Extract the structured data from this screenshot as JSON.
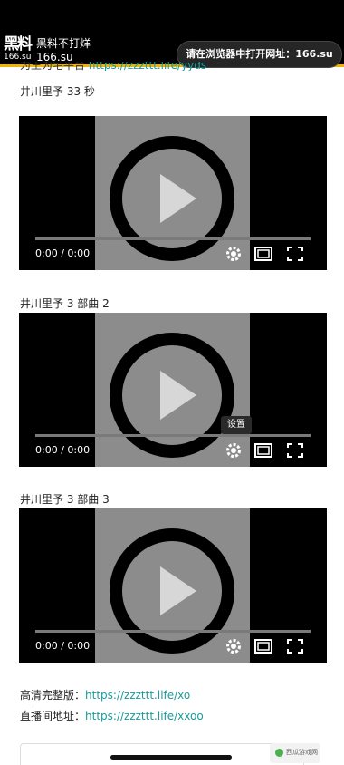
{
  "banner": {
    "logo_main": "黑料",
    "logo_sub": "166.su",
    "site_name": "黑料不打烊",
    "site_domain": "166.su",
    "pill_text": "请在浏览器中打开网址：166.su"
  },
  "partial_line": {
    "text": "为王为宅平台",
    "link": "https://zzzttt.life/yyds"
  },
  "videos": [
    {
      "title": "井川里予 33 秒",
      "time": "0:00 / 0:00"
    },
    {
      "title": "井川里予 3 部曲 2",
      "time": "0:00 / 0:00"
    },
    {
      "title": "井川里予 3 部曲 3",
      "time": "0:00 / 0:00"
    }
  ],
  "tooltip": "设置",
  "links": [
    {
      "label": "高清完整版：",
      "url": "https://zzzttt.life/xo"
    },
    {
      "label": "直播间地址：",
      "url": "https://zzzttt.life/xxoo"
    }
  ],
  "watermark": "西瓜游戏网",
  "colors": {
    "accent": "#f0b400",
    "link": "#1a9a9a",
    "video_bg": "#000000",
    "poster": "#8c8c8c"
  },
  "icons": [
    "play-icon",
    "settings-gear-icon",
    "picture-in-picture-icon",
    "fullscreen-icon"
  ]
}
